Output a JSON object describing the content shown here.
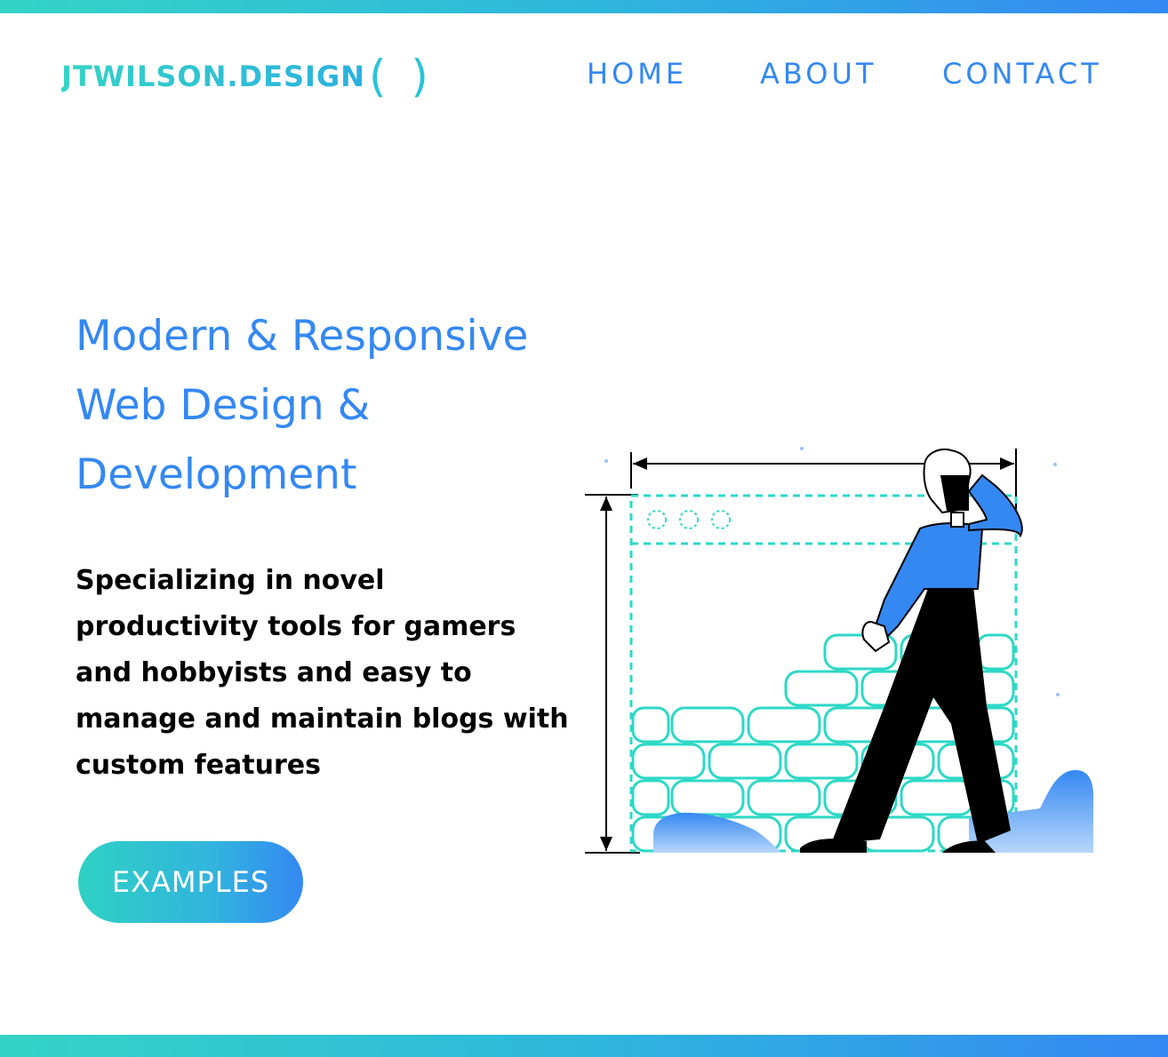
{
  "brand": {
    "name": "JTWILSON.DESIGN",
    "parens": "( )"
  },
  "nav": {
    "items": [
      {
        "label": "HOME"
      },
      {
        "label": "ABOUT"
      },
      {
        "label": "CONTACT"
      }
    ]
  },
  "hero": {
    "headline": "Modern & Responsive Web Design & Development",
    "subtext": "Specializing in novel productivity tools for gamers and hobbyists and easy to manage and maintain blogs with custom features",
    "cta_label": "EXAMPLES"
  },
  "colors": {
    "accent_blue": "#3488f2",
    "accent_teal": "#35d3c6",
    "text_dark": "#000000",
    "background": "#ffffff"
  },
  "icons": {
    "illustration": "person-building-brick-wall-illustration"
  }
}
